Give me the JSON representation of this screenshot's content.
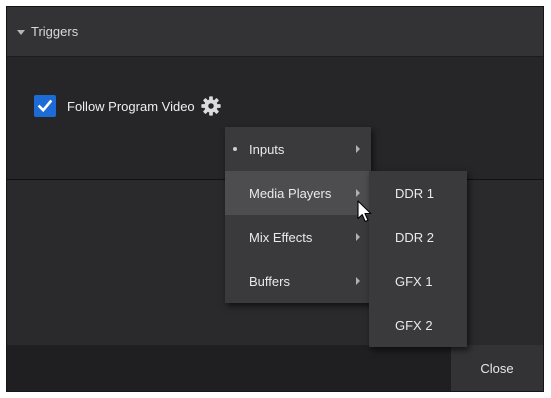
{
  "section": {
    "title": "Triggers",
    "expand_icon": "triangle-down-icon"
  },
  "trigger": {
    "checkbox_checked": true,
    "label": "Follow Program Video",
    "settings_icon": "gear-icon"
  },
  "context_menu": {
    "items": [
      {
        "label": "Inputs",
        "has_submenu": true,
        "marked": true
      },
      {
        "label": "Media Players",
        "has_submenu": true,
        "hovered": true
      },
      {
        "label": "Mix Effects",
        "has_submenu": true
      },
      {
        "label": "Buffers",
        "has_submenu": true
      }
    ],
    "submenu": {
      "parent": "Media Players",
      "items": [
        {
          "label": "DDR 1"
        },
        {
          "label": "DDR 2"
        },
        {
          "label": "GFX 1"
        },
        {
          "label": "GFX 2"
        }
      ]
    }
  },
  "footer": {
    "close_label": "Close"
  },
  "colors": {
    "accent": "#1d6bd6",
    "panel": "#2c2c2e",
    "menu": "#3a3a3c",
    "menu_hover": "#4d4d50"
  }
}
